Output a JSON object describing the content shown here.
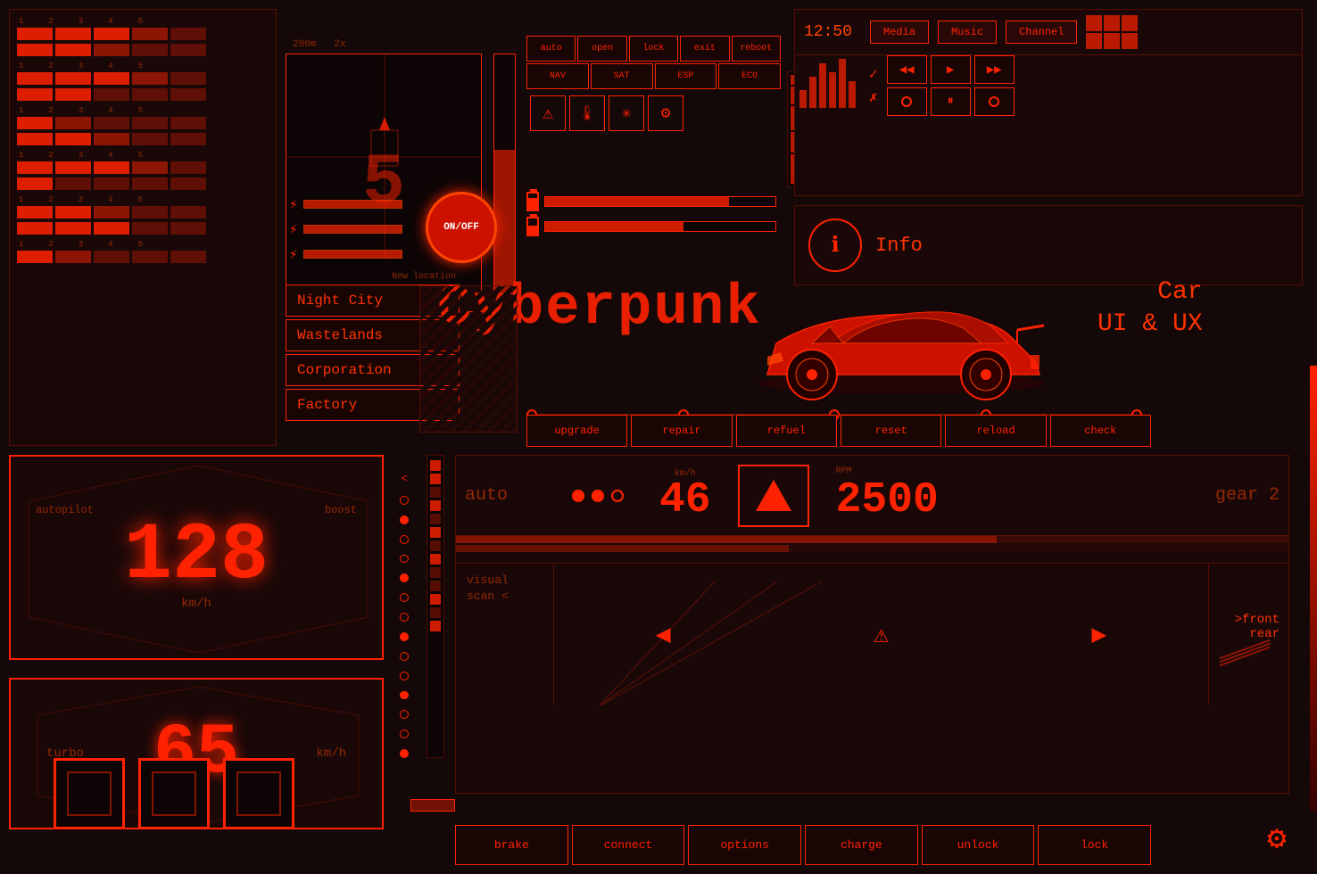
{
  "app": {
    "title": "Cyberpunk Car UI & UX",
    "background_color": "#150808",
    "accent_color": "#ff2200"
  },
  "map": {
    "distance": "200m",
    "zoom": "2x",
    "number": "5"
  },
  "time": "12:50",
  "media": {
    "btn1": "Media",
    "btn2": "Music",
    "btn3": "Channel"
  },
  "controls": {
    "btn_auto": "auto",
    "btn_open": "open",
    "btn_lock": "lock",
    "btn_exit": "exit",
    "btn_reboot": "reboot",
    "btn_nav": "NAV",
    "btn_sat": "SAT",
    "btn_esp": "ESP",
    "btn_eco": "ECO"
  },
  "power_btn": "ON/OFF",
  "info": {
    "label": "Info"
  },
  "locations": {
    "label": "New location",
    "items": [
      "Night City",
      "Wastelands",
      "Corporation",
      "Factory"
    ]
  },
  "title": "Cyberpunk",
  "car_label": "Car\nUI & UX",
  "car_subtitle1": "Car",
  "car_subtitle2": "UI & UX",
  "car_actions": {
    "upgrade": "upgrade",
    "repair": "repair",
    "refuel": "refuel",
    "reset": "reset",
    "reload": "reload",
    "check": "check"
  },
  "drive": {
    "mode": "auto",
    "speed_kmh": "46",
    "speed_unit": "km/h",
    "rpm": "2500",
    "rpm_label": "RPM",
    "gear": "gear 2"
  },
  "speedometer": {
    "speed": "128",
    "unit": "km/h",
    "left_label": "autopilot",
    "right_label": "boost"
  },
  "turbo": {
    "speed": "65",
    "unit": "km/h",
    "left_label": "turbo"
  },
  "visual_scan": {
    "label": "visual\nscan <",
    "front": ">front",
    "rear": "rear"
  },
  "bottom_buttons": {
    "brake": "brake",
    "connect": "connect",
    "options": "options",
    "charge": "charge",
    "unlock": "unlock",
    "lock": "lock"
  },
  "progress_bars": [
    {
      "segments": [
        5,
        4,
        3,
        2,
        1
      ]
    },
    {
      "segments": [
        5,
        5,
        4,
        3,
        2
      ]
    },
    {
      "segments": [
        5,
        4,
        4,
        3,
        1
      ]
    },
    {
      "segments": [
        5,
        3,
        2,
        1,
        1
      ]
    },
    {
      "segments": [
        5,
        5,
        3,
        2,
        1
      ]
    },
    {
      "segments": [
        5,
        4,
        2,
        1,
        0
      ]
    },
    {
      "segments": [
        5,
        3,
        3,
        2,
        1
      ]
    },
    {
      "segments": [
        5,
        5,
        4,
        2,
        1
      ]
    }
  ],
  "eq_bars": [
    20,
    35,
    50,
    40,
    55,
    45,
    30,
    60,
    50,
    35
  ],
  "battery": {
    "bar1_width": "80%",
    "bar2_width": "60%"
  }
}
